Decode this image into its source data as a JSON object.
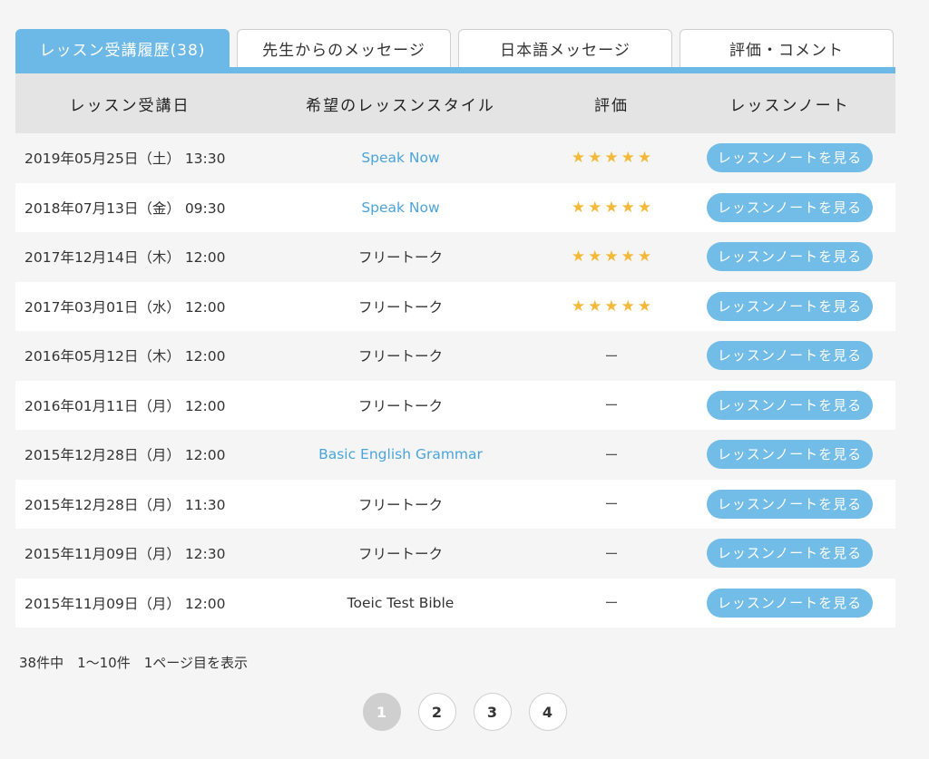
{
  "tabs": [
    {
      "label": "レッスン受講履歴(38)",
      "active": true
    },
    {
      "label": "先生からのメッセージ",
      "active": false
    },
    {
      "label": "日本語メッセージ",
      "active": false
    },
    {
      "label": "評価・コメント",
      "active": false
    }
  ],
  "table": {
    "headers": {
      "date": "レッスン受講日",
      "style": "希望のレッスンスタイル",
      "rating": "評価",
      "note": "レッスンノート"
    },
    "rows": [
      {
        "date": "2019年05月25日（土） 13:30",
        "style": "Speak Now",
        "style_link": true,
        "stars": 5,
        "rating_text": "",
        "note_label": "レッスンノートを見る"
      },
      {
        "date": "2018年07月13日（金） 09:30",
        "style": "Speak Now",
        "style_link": true,
        "stars": 5,
        "rating_text": "",
        "note_label": "レッスンノートを見る"
      },
      {
        "date": "2017年12月14日（木） 12:00",
        "style": "フリートーク",
        "style_link": false,
        "stars": 5,
        "rating_text": "",
        "note_label": "レッスンノートを見る"
      },
      {
        "date": "2017年03月01日（水） 12:00",
        "style": "フリートーク",
        "style_link": false,
        "stars": 5,
        "rating_text": "",
        "note_label": "レッスンノートを見る"
      },
      {
        "date": "2016年05月12日（木） 12:00",
        "style": "フリートーク",
        "style_link": false,
        "stars": 0,
        "rating_text": "ー",
        "note_label": "レッスンノートを見る"
      },
      {
        "date": "2016年01月11日（月） 12:00",
        "style": "フリートーク",
        "style_link": false,
        "stars": 0,
        "rating_text": "ー",
        "note_label": "レッスンノートを見る"
      },
      {
        "date": "2015年12月28日（月） 12:00",
        "style": "Basic English Grammar",
        "style_link": true,
        "stars": 0,
        "rating_text": "ー",
        "note_label": "レッスンノートを見る"
      },
      {
        "date": "2015年12月28日（月） 11:30",
        "style": "フリートーク",
        "style_link": false,
        "stars": 0,
        "rating_text": "ー",
        "note_label": "レッスンノートを見る"
      },
      {
        "date": "2015年11月09日（月） 12:30",
        "style": "フリートーク",
        "style_link": false,
        "stars": 0,
        "rating_text": "ー",
        "note_label": "レッスンノートを見る"
      },
      {
        "date": "2015年11月09日（月） 12:00",
        "style": "Toeic Test Bible",
        "style_link": false,
        "stars": 0,
        "rating_text": "ー",
        "note_label": "レッスンノートを見る"
      }
    ]
  },
  "summary": "38件中　1〜10件　1ページ目を表示",
  "pagination": {
    "pages": [
      "1",
      "2",
      "3",
      "4"
    ],
    "current": "1"
  },
  "colors": {
    "accent": "#6cb8e6",
    "link": "#4ba5dc",
    "star": "#f5b93a",
    "button": "#72bce8"
  },
  "icons": {
    "star": "star-icon"
  }
}
